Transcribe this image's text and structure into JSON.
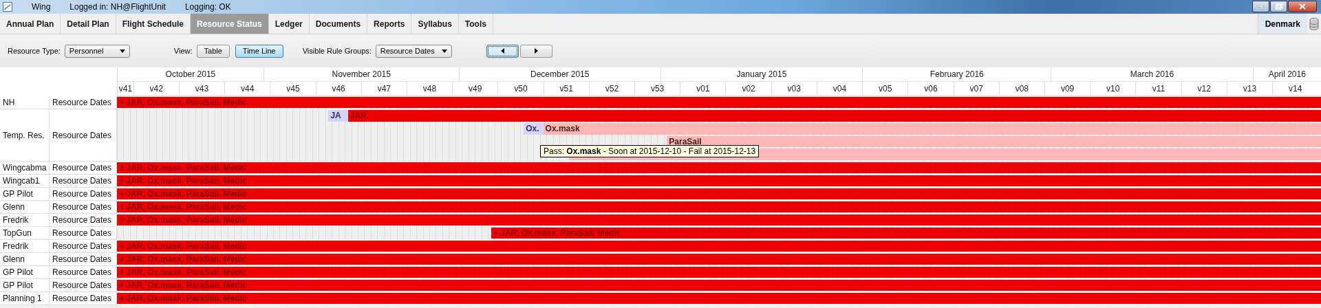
{
  "window": {
    "title": "Wing",
    "login": "Logged in: NH@FlightUnit",
    "logging": "Logging: OK"
  },
  "tabs": [
    {
      "label": "Annual Plan",
      "selected": false
    },
    {
      "label": "Detail Plan",
      "selected": false
    },
    {
      "label": "Flight Schedule",
      "selected": false
    },
    {
      "label": "Resource Status",
      "selected": true
    },
    {
      "label": "Ledger",
      "selected": false
    },
    {
      "label": "Documents",
      "selected": false
    },
    {
      "label": "Reports",
      "selected": false
    },
    {
      "label": "Syllabus",
      "selected": false
    },
    {
      "label": "Tools",
      "selected": false
    }
  ],
  "region": "Denmark",
  "toolbar": {
    "resource_type": {
      "label": "Resource Type:",
      "value": "Personnel"
    },
    "view": {
      "label": "View:",
      "options": [
        {
          "label": "Table",
          "selected": false
        },
        {
          "label": "Time Line",
          "selected": true
        }
      ]
    },
    "rule_groups": {
      "label": "Visible Rule Groups:",
      "value": "Resource Dates"
    },
    "nav": [
      {
        "kind": "prev",
        "focused": true
      },
      {
        "kind": "next",
        "focused": false
      }
    ]
  },
  "months": [
    "October 2015",
    "November 2015",
    "December 2015",
    "January 2015",
    "February 2016",
    "March 2016",
    "April 2016"
  ],
  "weeks": [
    "v41",
    "v42",
    "v43",
    "v44",
    "v45",
    "v46",
    "v47",
    "v48",
    "v49",
    "v50",
    "v51",
    "v52",
    "v53",
    "v01",
    "v02",
    "v03",
    "v04",
    "v05",
    "v06",
    "v07",
    "v08",
    "v09",
    "v10",
    "v11",
    "v12",
    "v13",
    "v14"
  ],
  "rows": [
    {
      "name": "NH",
      "group": "Resource Dates",
      "lanes": [
        [
          {
            "kind": "fail",
            "label": "+ JAR, Ox.mask, ParaSail, Medic"
          }
        ]
      ]
    },
    {
      "name": "Temp. Res.",
      "group": "Resource Dates",
      "lanes": [
        [
          {
            "kind": "pass",
            "label": "JA"
          },
          {
            "kind": "fail",
            "label": "JAR"
          }
        ],
        [
          {
            "kind": "pass",
            "label": "Ox."
          },
          {
            "kind": "soon",
            "label": "Ox.mask"
          }
        ],
        [
          {
            "kind": "soon",
            "label": "ParaSail"
          }
        ],
        [
          {
            "kind": "soon"
          }
        ]
      ]
    },
    {
      "name": "Wingcabma",
      "group": "Resource Dates",
      "lanes": [
        [
          {
            "kind": "fail",
            "label": "+ JAR, Ox.mask, ParaSail, Medic"
          }
        ]
      ]
    },
    {
      "name": "Wingcab1",
      "group": "Resource Dates",
      "lanes": [
        [
          {
            "kind": "fail",
            "label": "+ JAR, Ox.mask, ParaSail, Medic"
          }
        ]
      ]
    },
    {
      "name": "GP Pilot",
      "group": "Resource Dates",
      "lanes": [
        [
          {
            "kind": "fail",
            "label": "+ JAR, Ox.mask, ParaSail, Medic"
          }
        ]
      ]
    },
    {
      "name": "Glenn",
      "group": "Resource Dates",
      "lanes": [
        [
          {
            "kind": "fail",
            "label": "+ JAR, Ox.mask, ParaSail, Medic"
          }
        ]
      ]
    },
    {
      "name": "Fredrik",
      "group": "Resource Dates",
      "lanes": [
        [
          {
            "kind": "fail",
            "label": "+ JAR, Ox.mask, ParaSail, Medic"
          }
        ]
      ]
    },
    {
      "name": "TopGun",
      "group": "Resource Dates",
      "lanes": [
        [
          {
            "kind": "fail",
            "label": "+ JAR, Ox.mask, ParaSail, Medic"
          }
        ]
      ]
    },
    {
      "name": "Fredrik",
      "group": "Resource Dates",
      "lanes": [
        [
          {
            "kind": "fail",
            "label": "+ JAR, Ox.mask, ParaSail, Medic"
          }
        ]
      ]
    },
    {
      "name": "Glenn",
      "group": "Resource Dates",
      "lanes": [
        [
          {
            "kind": "fail",
            "label": "+ JAR, Ox.mask, ParaSail, Medic"
          }
        ]
      ]
    },
    {
      "name": "GP Pilot",
      "group": "Resource Dates",
      "lanes": [
        [
          {
            "kind": "fail",
            "label": "+ JAR, Ox.mask, ParaSail, Medic"
          }
        ]
      ]
    },
    {
      "name": "GP Pilot",
      "group": "Resource Dates",
      "lanes": [
        [
          {
            "kind": "fail",
            "label": "+ JAR, Ox.mask, ParaSail, Medic"
          }
        ]
      ]
    },
    {
      "name": "Planning 1",
      "group": "Resource Dates",
      "lanes": [
        [
          {
            "kind": "fail",
            "label": "+ JAR, Ox.mask, ParaSail, Medic"
          }
        ]
      ]
    }
  ],
  "tooltip": "Pass: **Ox.mask** - Soon at 2015-12-10 - Fail at 2015-12-13"
}
